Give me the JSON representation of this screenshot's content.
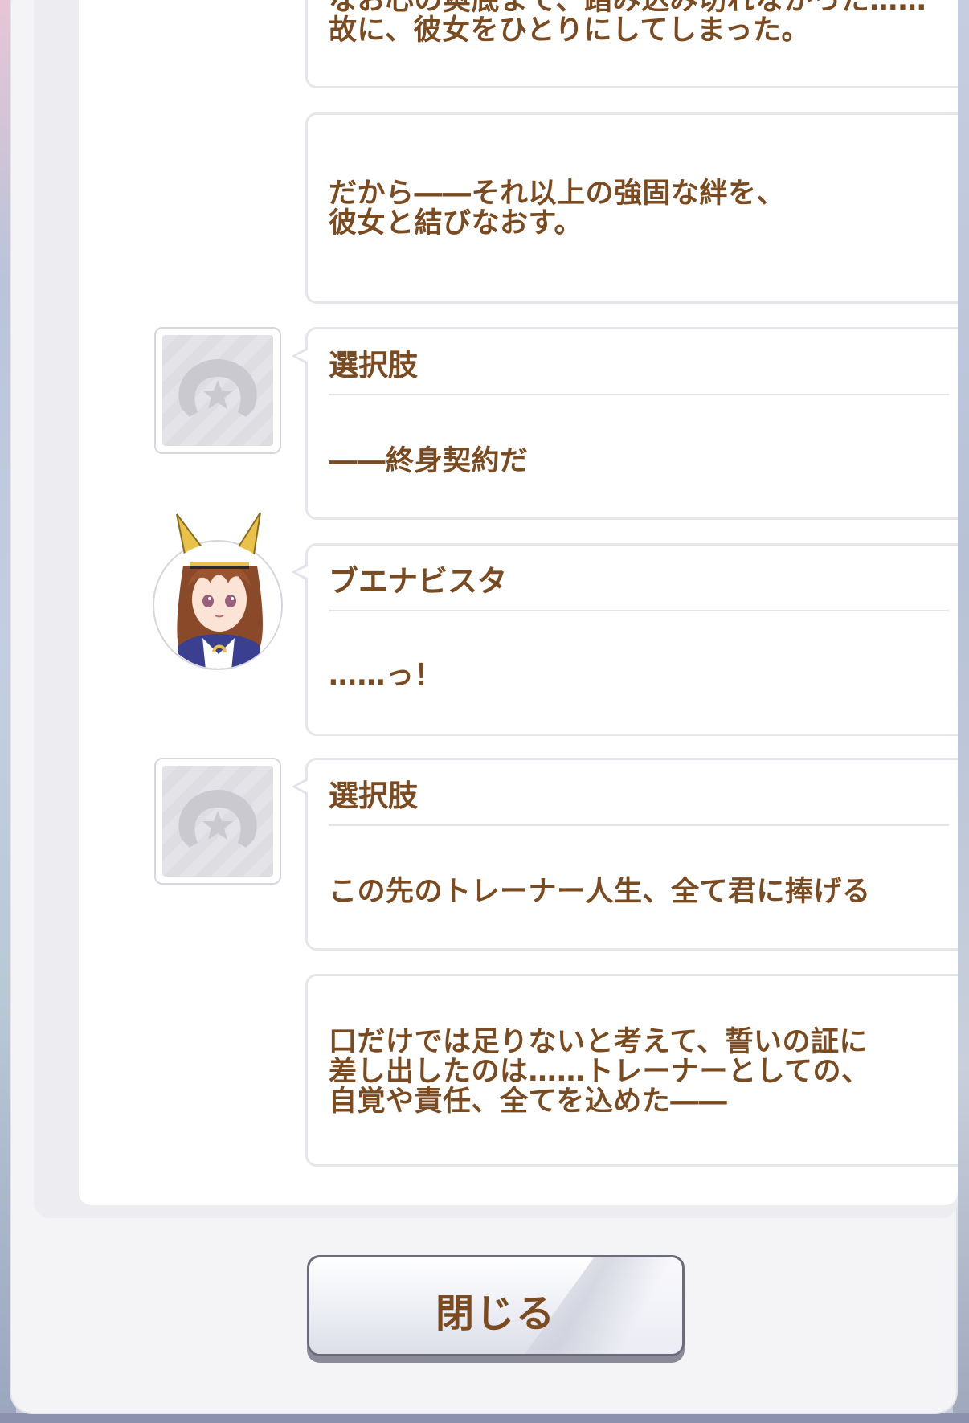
{
  "log": [
    {
      "type": "narration",
      "text": "なお心の奥底まで、踏み込み切れなかった……\n故に、彼女をひとりにしてしまった。"
    },
    {
      "type": "narration",
      "text": "だから――それ以上の強固な絆を、\n彼女と結びなおす。"
    },
    {
      "type": "choice",
      "speaker": "選択肢",
      "text": "――終身契約だ"
    },
    {
      "type": "dialogue",
      "speaker": "ブエナビスタ",
      "text": "……っ！"
    },
    {
      "type": "choice",
      "speaker": "選択肢",
      "text": "この先のトレーナー人生、全て君に捧げる"
    },
    {
      "type": "narration",
      "text": "口だけでは足りないと考えて、誓いの証に\n差し出したのは……トレーナーとしての、\n自覚や責任、全てを込めた――"
    }
  ],
  "close_button_label": "閉じる",
  "icons": {
    "choice_avatar": "horseshoe-star-icon",
    "character_avatar": "buena-vista-portrait"
  },
  "colors": {
    "text": "#7a4a21",
    "bubble_border": "#e6e6ea",
    "scrollbar": "#686c82"
  }
}
